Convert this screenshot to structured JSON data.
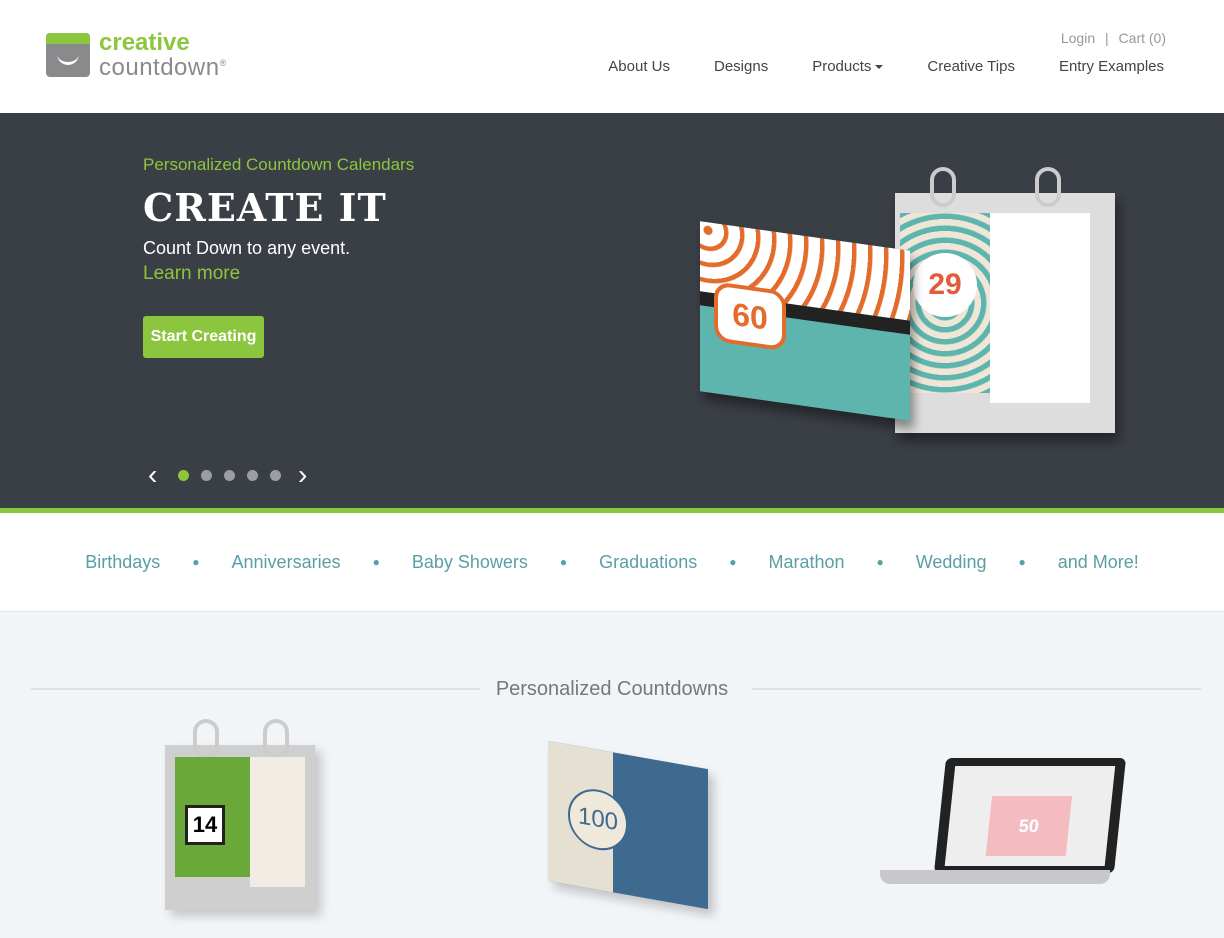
{
  "brand": {
    "line1": "creative",
    "line2": "countdown",
    "reg": "®"
  },
  "top_links": {
    "login": "Login",
    "separator": "|",
    "cart": "Cart (0)"
  },
  "nav": {
    "items": [
      "About Us",
      "Designs",
      "Products",
      "Creative Tips",
      "Entry Examples"
    ]
  },
  "hero": {
    "kicker": "Personalized Countdown Calendars",
    "title": "CREATE IT",
    "subtitle": "Count Down to any event.",
    "learn_more": "Learn more",
    "cta": "Start Creating",
    "slide_count": 5,
    "active_slide": 1,
    "card1": {
      "number": "60"
    },
    "card2": {
      "number": "29"
    }
  },
  "categories": [
    "Birthdays",
    "Anniversaries",
    "Baby Showers",
    "Graduations",
    "Marathon",
    "Wedding",
    "and More!"
  ],
  "section": {
    "title": "Personalized Countdowns"
  },
  "products": {
    "flip_number": "14",
    "gift_number": "100",
    "email_number": "50"
  },
  "colors": {
    "green": "#8cc63f",
    "hero_bg": "#3a3e45",
    "teal": "#5a9ea6"
  }
}
